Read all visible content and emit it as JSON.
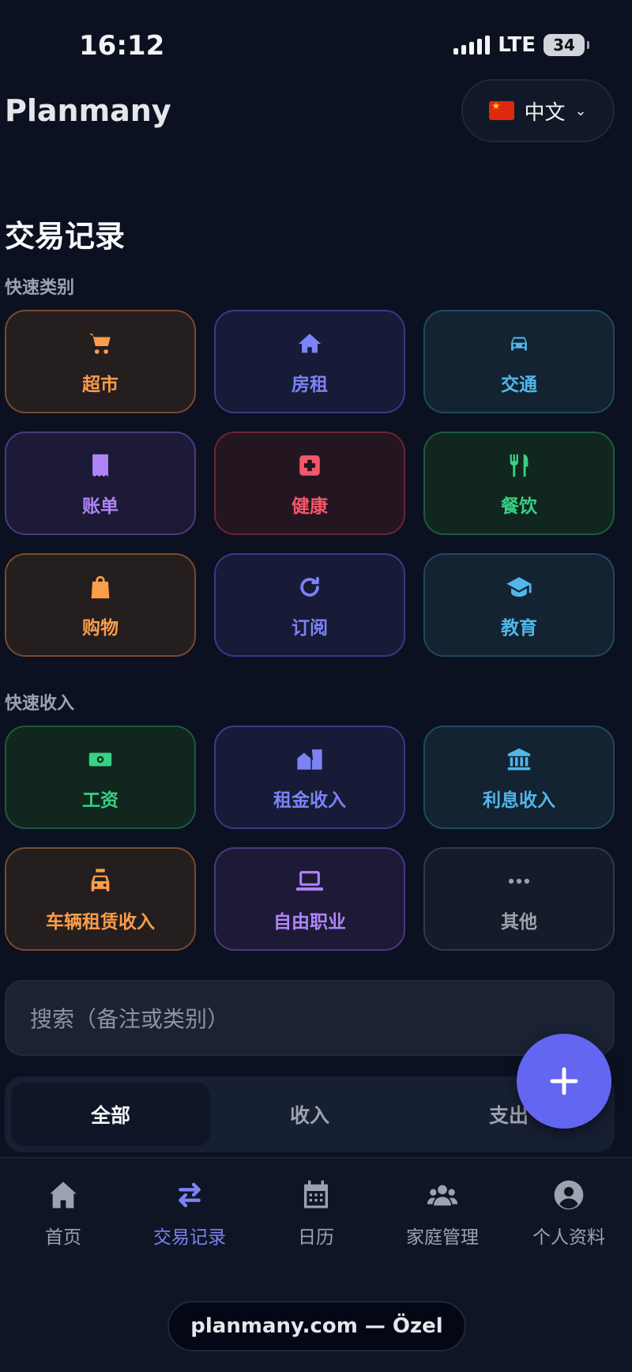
{
  "status_bar": {
    "time": "16:12",
    "network": "LTE",
    "battery": "34"
  },
  "header": {
    "brand": "Planmany",
    "language": "中文"
  },
  "page": {
    "title": "交易记录"
  },
  "quick_categories": {
    "label": "快速类别",
    "items": [
      {
        "label": "超市",
        "icon": "cart-icon",
        "color": "#fb9d4a"
      },
      {
        "label": "房租",
        "icon": "house-icon",
        "color": "#7b83f5"
      },
      {
        "label": "交通",
        "icon": "car-icon",
        "color": "#52b6e8"
      },
      {
        "label": "账单",
        "icon": "receipt-icon",
        "color": "#b084f7"
      },
      {
        "label": "健康",
        "icon": "medical-icon",
        "color": "#f3576a"
      },
      {
        "label": "餐饮",
        "icon": "utensils-icon",
        "color": "#38d185"
      },
      {
        "label": "购物",
        "icon": "shopping-bag-icon",
        "color": "#fb9d4a"
      },
      {
        "label": "订阅",
        "icon": "refresh-icon",
        "color": "#7b83f5"
      },
      {
        "label": "教育",
        "icon": "graduation-cap-icon",
        "color": "#52b6e8"
      }
    ]
  },
  "quick_income": {
    "label": "快速收入",
    "items": [
      {
        "label": "工资",
        "icon": "money-icon",
        "color": "#38d185"
      },
      {
        "label": "租金收入",
        "icon": "building-icon",
        "color": "#7b83f5"
      },
      {
        "label": "利息收入",
        "icon": "bank-icon",
        "color": "#52b6e8"
      },
      {
        "label": "车辆租赁收入",
        "icon": "taxi-icon",
        "color": "#fb9d4a"
      },
      {
        "label": "自由职业",
        "icon": "laptop-icon",
        "color": "#b084f7"
      },
      {
        "label": "其他",
        "icon": "more-icon",
        "color": "#9ca3af"
      }
    ]
  },
  "search": {
    "placeholder": "搜索（备注或类别）"
  },
  "filter": {
    "tabs": [
      "全部",
      "收入",
      "支出"
    ],
    "selected": "全部"
  },
  "bottom_nav": {
    "items": [
      {
        "label": "首页",
        "icon": "home-icon"
      },
      {
        "label": "交易记录",
        "icon": "transfer-icon"
      },
      {
        "label": "日历",
        "icon": "calendar-icon"
      },
      {
        "label": "家庭管理",
        "icon": "users-icon"
      },
      {
        "label": "个人资料",
        "icon": "user-circle-icon"
      }
    ],
    "active": "交易记录"
  },
  "footer": {
    "url": "planmany.com — Özel"
  }
}
